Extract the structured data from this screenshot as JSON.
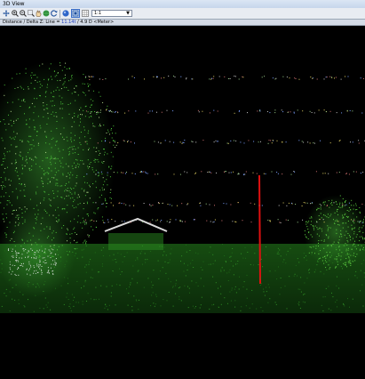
{
  "window": {
    "title": "3D View"
  },
  "toolbar": {
    "icons": [
      "pan-icon",
      "zoom-in-icon",
      "zoom-out-icon",
      "hand-icon",
      "globe-icon",
      "refresh-icon",
      "sphere-icon",
      "fit-view-icon",
      "mesh-view-icon"
    ],
    "zoom_value": "1:1"
  },
  "status": {
    "label": "Distance / Delta Z: Line = ",
    "value": "11.14t",
    "suffix": " / 4.9 D <Meter>"
  },
  "viewport": {
    "content": "point-cloud"
  }
}
